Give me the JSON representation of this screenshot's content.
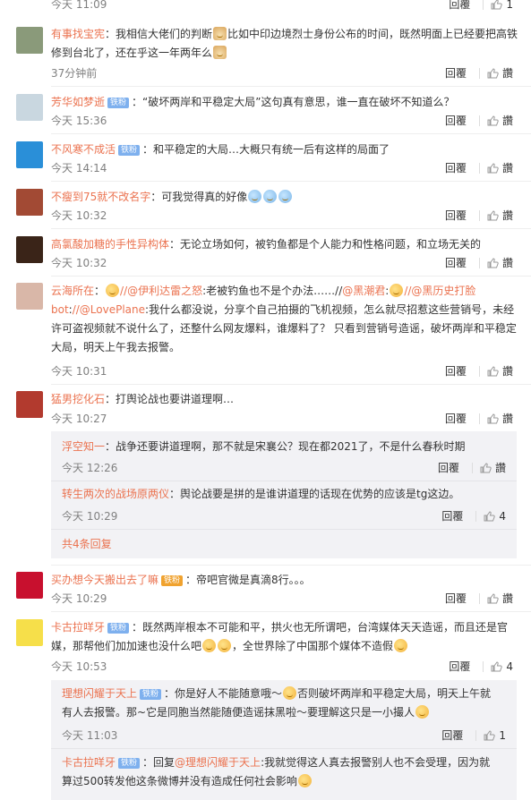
{
  "reply_label": "回覆",
  "like_label": "讚",
  "c0": {
    "time": "今天 11:09",
    "likes": "1"
  },
  "c1": {
    "name": "有事找宝宪",
    "text_a": "：我相信大佬们的判断",
    "text_b": "比如中印边境烈士身份公布的时间，既然明面上已经要把高铁修到台北了，还在乎这一年两年么",
    "time": "37分钟前"
  },
  "c2": {
    "name": "芳华如梦逝",
    "badge": "铁粉",
    "text": "：“破坏两岸和平稳定大局”这句真有意思，谁一直在破坏不知道么？",
    "time": "今天 15:36"
  },
  "c3": {
    "name": "不风寒不成活",
    "badge": "铁粉",
    "text": "：和平稳定的大局…大概只有统一后有这样的局面了",
    "time": "今天 14:14"
  },
  "c4": {
    "name": "不瘦到75就不改名字",
    "text": "：可我觉得真的好像",
    "time": "今天 10:32"
  },
  "c5": {
    "name": "高氯酸加糖的手性异构体",
    "text": "：无论立场如何，被钓鱼都是个人能力和性格问题，和立场无关的",
    "time": "今天 10:32"
  },
  "c6": {
    "name": "云海所在",
    "text_a": "：",
    "at1": "//@伊利达雷之怒",
    "text_b": ":老被钓鱼也不是个办法……//",
    "at2": "@黑潮君",
    "text_c": ":",
    "at3": "//@黑历史打脸bot",
    "text_d": ":",
    "at4": "//@LovePlane",
    "text_e": ":我什么都没说，分享个自己拍摄的飞机视频，怎么就尽招惹这些营销号，未经许可盗视频就不说什么了，还整什么网友爆料，谁爆料了？ 只看到营销号造谣，破坏两岸和平稳定大局，明天上午我去报警。",
    "time": "今天 10:31"
  },
  "c7": {
    "name": "猛男挖化石",
    "text": "：打舆论战也要讲道理啊…",
    "time": "今天 10:27",
    "sub": [
      {
        "name": "浮空知一",
        "text": "：战争还要讲道理啊，那不就是宋襄公？现在都2021了，不是什么春秋时期",
        "time": "今天 12:26"
      },
      {
        "name": "转生两次的战场原两仪",
        "text": "：舆论战要是拼的是谁讲道理的话现在优势的应该是tg这边。",
        "time": "今天 10:29",
        "likes": "4"
      }
    ],
    "more": "共4条回复"
  },
  "c8": {
    "name": "买办想今天搬出去了嘛",
    "badge": "铁粉",
    "text": "：帝吧官微是真滴8行。。。",
    "time": "今天 10:29"
  },
  "c9": {
    "name": "卡古拉咩牙",
    "badge": "铁粉",
    "text_a": "：既然两岸根本不可能和平，拱火也无所谓吧，台湾媒体天天造谣，而且还是官媒，那帮他们加加速也没什么吧",
    "text_b": "，全世界除了中国那个媒体不造假",
    "time": "今天 10:53",
    "likes": "4",
    "sub": [
      {
        "name": "理想闪耀于天上",
        "badge": "铁粉",
        "text_a": "：你是好人不能随意哦～",
        "text_b": "否则破坏两岸和平稳定大局，明天上午就有人去报警。那~它是同胞当然能随便造谣抹黑啦～要理解这只是一小撮人",
        "time": "今天 11:03",
        "likes": "1"
      },
      {
        "name": "卡古拉咩牙",
        "badge": "铁粉",
        "text_a": "：回复",
        "at": "@理想闪耀于天上",
        "text_b": ":我就觉得这人真去报警别人也不会受理，因为就算过500转发他这条微博并没有造成任何社会影响"
      }
    ]
  }
}
